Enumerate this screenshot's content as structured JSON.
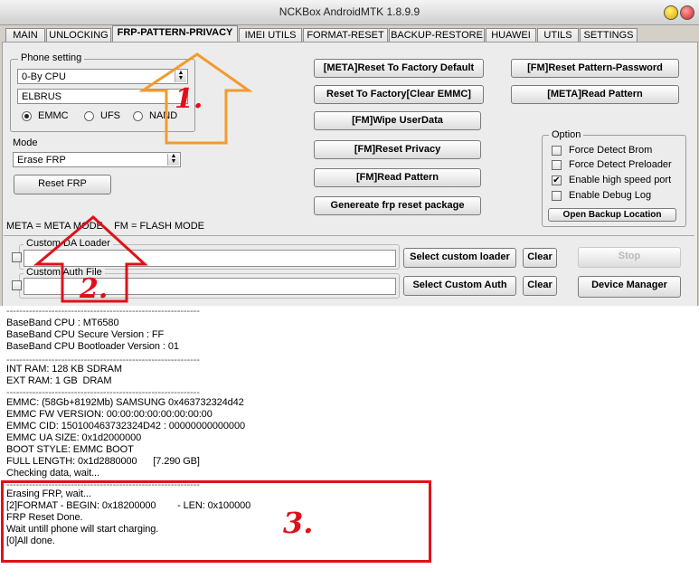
{
  "window": {
    "title": "NCKBox AndroidMTK 1.8.9.9"
  },
  "tabs": [
    {
      "label": "MAIN"
    },
    {
      "label": "UNLOCKING"
    },
    {
      "label": "FRP-PATTERN-PRIVACY"
    },
    {
      "label": "IMEI UTILS"
    },
    {
      "label": "FORMAT-RESET"
    },
    {
      "label": "BACKUP-RESTORE"
    },
    {
      "label": "HUAWEI"
    },
    {
      "label": "UTILS"
    },
    {
      "label": "SETTINGS"
    }
  ],
  "phone_setting": {
    "label": "Phone setting",
    "cpu": "0-By CPU",
    "model": "ELBRUS",
    "storage": [
      {
        "label": "EMMC",
        "selected": true
      },
      {
        "label": "UFS",
        "selected": false
      },
      {
        "label": "NAND",
        "selected": false
      }
    ]
  },
  "mode": {
    "label": "Mode",
    "value": "Erase FRP",
    "reset_button": "Reset FRP"
  },
  "actions": {
    "meta_reset_factory_default": "[META]Reset To Factory Default",
    "reset_factory_clear_emmc": "Reset To Factory[Clear EMMC]",
    "fm_wipe_userdata": "[FM]Wipe UserData",
    "fm_reset_privacy": "[FM]Reset Privacy",
    "fm_read_pattern": "[FM]Read Pattern",
    "generate_frp_package": "Genereate frp reset package",
    "fm_reset_pattern_password": "[FM]Reset Pattern-Password",
    "meta_read_pattern": "[META]Read Pattern"
  },
  "options": {
    "label": "Option",
    "items": [
      {
        "label": "Force Detect Brom",
        "checked": false
      },
      {
        "label": "Force Detect Preloader",
        "checked": false
      },
      {
        "label": "Enable high speed port",
        "checked": true
      },
      {
        "label": "Enable Debug Log",
        "checked": false
      }
    ],
    "open_backup": "Open Backup Location"
  },
  "legend": "META = META MODE    FM = FLASH MODE",
  "custom": {
    "da_label": "Custom DA Loader",
    "auth_label": "Custom Auth File",
    "select_loader": "Select custom loader",
    "select_auth": "Select Custom Auth",
    "clear": "Clear",
    "stop": "Stop",
    "device_manager": "Device Manager"
  },
  "log": [
    {
      "text": "------------------------------------------------------------",
      "dash": true
    },
    {
      "text": "BaseBand CPU : MT6580"
    },
    {
      "text": "BaseBand CPU Secure Version : FF"
    },
    {
      "text": "BaseBand CPU Bootloader Version : 01"
    },
    {
      "text": "------------------------------------------------------------",
      "dash": true
    },
    {
      "text": "INT RAM: 128 KB SDRAM"
    },
    {
      "text": "EXT RAM: 1 GB  DRAM"
    },
    {
      "text": "------------------------------------------------------------",
      "dash": true
    },
    {
      "text": "EMMC: (58Gb+8192Mb) SAMSUNG 0x463732324d42"
    },
    {
      "text": "EMMC FW VERSION: 00:00:00:00:00:00:00:00"
    },
    {
      "text": "EMMC CID: 150100463732324D42 : 00000000000000"
    },
    {
      "text": "EMMC UA SIZE: 0x1d2000000"
    },
    {
      "text": "BOOT STYLE: EMMC BOOT"
    },
    {
      "text": "FULL LENGTH: 0x1d2880000      [7.290 GB]"
    },
    {
      "text": "Checking data, wait..."
    },
    {
      "text": "------------------------------------------------------------",
      "dash": true
    },
    {
      "text": "Erasing FRP, wait..."
    },
    {
      "text": "[2]FORMAT - BEGIN: 0x18200000        - LEN: 0x100000"
    },
    {
      "text": "FRP Reset Done."
    },
    {
      "text": "Wait untill phone will start charging."
    },
    {
      "text": "[0]All done."
    }
  ],
  "annotations": {
    "one": "1.",
    "two": "2.",
    "three": "3."
  },
  "colors": {
    "annotation": "#e0101a",
    "accent": "#0a50c8"
  }
}
